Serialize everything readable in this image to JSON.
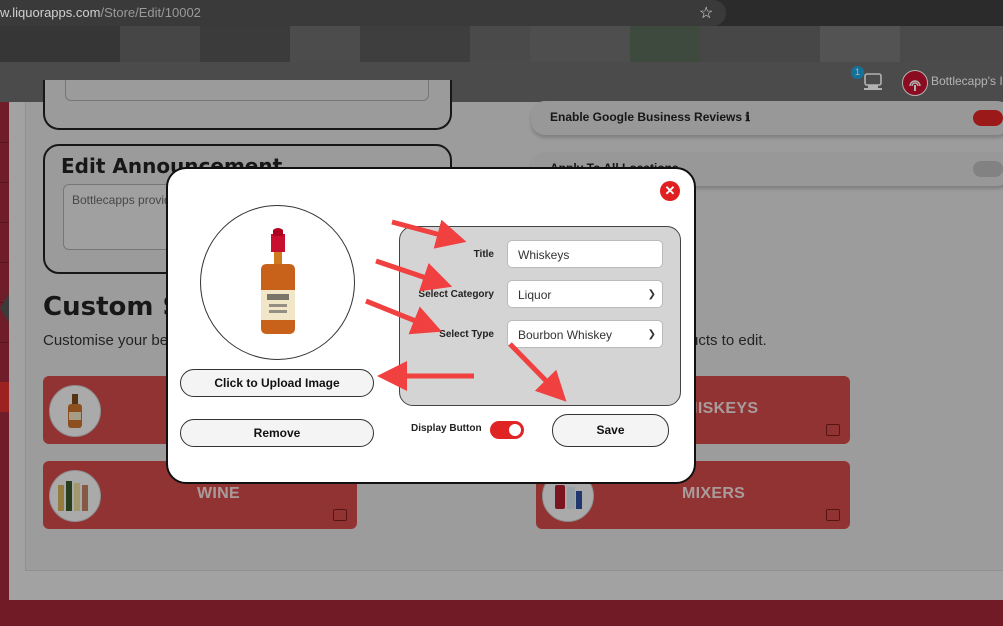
{
  "browser": {
    "url_prefix": "w.liquorapps.com",
    "url_path": "/Store/Edit/10002",
    "star_icon": "star-icon"
  },
  "appbar": {
    "notification_count": "1",
    "user_name": "Bottlecapp's Irv"
  },
  "page": {
    "edit_announcement_title": "Edit Announcement",
    "announcement_text": "Bottlecapps provid",
    "google_reviews_label": "Enable Google Business Reviews",
    "apply_all_label": "Apply To All Locations",
    "custom_title": "Custom S",
    "custom_subtitle": "Customise your be",
    "custom_subtitle_right": "ucts to edit.",
    "categories": [
      {
        "name": "",
        "icon": "bottle"
      },
      {
        "name": "HISKEYS",
        "icon": "none"
      },
      {
        "name": "WINE",
        "icon": "wine-bottles"
      },
      {
        "name": "MIXERS",
        "icon": "mixer-bottles"
      }
    ]
  },
  "modal": {
    "upload_button": "Click to Upload Image",
    "remove_button": "Remove",
    "title_label": "Title",
    "title_value": "Whiskeys",
    "category_label": "Select Category",
    "category_value": "Liquor",
    "type_label": "Select Type",
    "type_value": "Bourbon Whiskey",
    "display_button_label": "Display Button",
    "display_button_on": true,
    "save_button": "Save"
  },
  "colors": {
    "accent_red": "#d14a4a",
    "toggle_red": "#e02424",
    "annotation_arrow": "#f04040"
  }
}
